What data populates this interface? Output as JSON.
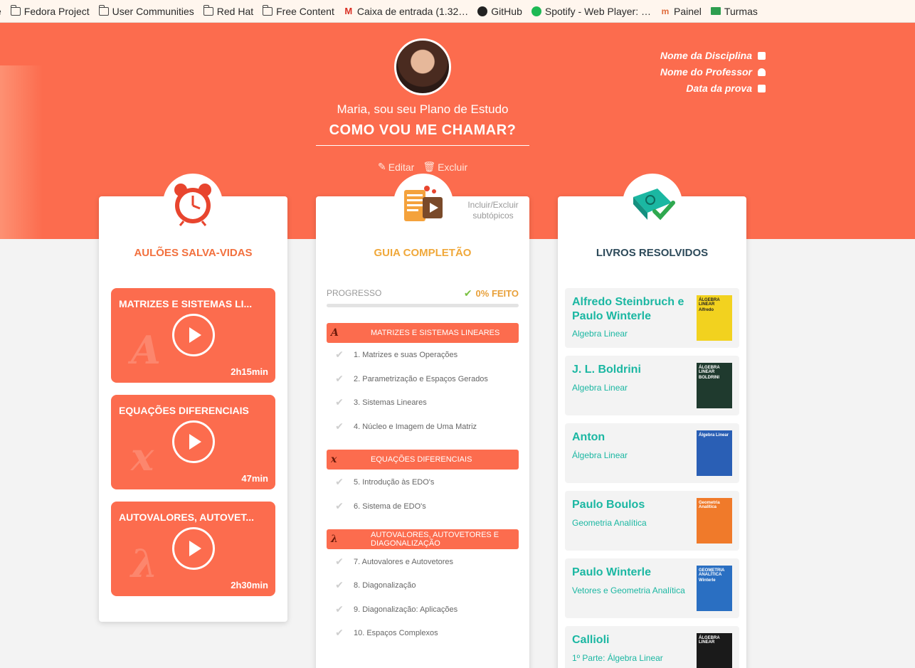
{
  "bookmarks": [
    {
      "label": "e",
      "icon": "none"
    },
    {
      "label": "Fedora Project",
      "icon": "folder-icon"
    },
    {
      "label": "User Communities",
      "icon": "folder-icon"
    },
    {
      "label": "Red Hat",
      "icon": "folder-icon"
    },
    {
      "label": "Free Content",
      "icon": "folder-icon"
    },
    {
      "label": "Caixa de entrada (1.32…",
      "icon": "gmail-icon"
    },
    {
      "label": "GitHub",
      "icon": "github-icon"
    },
    {
      "label": "Spotify - Web Player: …",
      "icon": "spotify-icon"
    },
    {
      "label": "Painel",
      "icon": "painel-icon"
    },
    {
      "label": "Turmas",
      "icon": "turmas-icon"
    }
  ],
  "header": {
    "intro": "Maria, sou seu Plano de Estudo",
    "name_placeholder": "COMO VOU ME CHAMAR?",
    "edit_label": "Editar",
    "delete_label": "Excluir",
    "links": {
      "discipline": "Nome da Disciplina",
      "professor": "Nome do Professor",
      "exam_date": "Data da prova"
    }
  },
  "videos_card": {
    "title": "AULÕES SALVA-VIDAS",
    "title_color": "#f2703e",
    "videos": [
      {
        "title": "MATRIZES E SISTEMAS LI...",
        "symbol": "A",
        "duration": "2h15min"
      },
      {
        "title": "EQUAÇÕES DIFERENCIAIS",
        "symbol": "x",
        "duration": "47min"
      },
      {
        "title": "AUTOVALORES, AUTOVET...",
        "symbol": "λ",
        "duration": "2h30min"
      }
    ]
  },
  "guide_card": {
    "title": "GUIA COMPLETÃO",
    "title_color": "#f0a83a",
    "include_label": "Incluir/Excluir subtópicos",
    "progress_label": "PROGRESSO",
    "progress_value": "0% FEITO",
    "progress_fraction": 0,
    "sections": [
      {
        "symbol": "A",
        "title": "MATRIZES E SISTEMAS LINEARES",
        "topics": [
          "1. Matrizes e suas Operações",
          "2. Parametrização e Espaços Gerados",
          "3. Sistemas Lineares",
          "4. Núcleo e Imagem de Uma Matriz"
        ]
      },
      {
        "symbol": "x",
        "title": "EQUAÇÕES DIFERENCIAIS",
        "topics": [
          "5. Introdução às EDO's",
          "6. Sistema de EDO's"
        ]
      },
      {
        "symbol": "λ",
        "title": "AUTOVALORES, AUTOVETORES E DIAGONALIZAÇÃO",
        "topics": [
          "7. Autovalores e Autovetores",
          "8. Diagonalização",
          "9. Diagonalização: Aplicações",
          "10. Espaços Complexos"
        ]
      }
    ]
  },
  "books_card": {
    "title": "LIVROS RESOLVIDOS",
    "title_color": "#2d4a5a",
    "books": [
      {
        "author": "Alfredo Steinbruch e Paulo Winterle",
        "subject": "Algebra Linear",
        "cover_color": "#f2d21f",
        "cover_text": "ÁLGEBRA LINEAR",
        "cover_sub": "Alfredo"
      },
      {
        "author": "J. L. Boldrini",
        "subject": "Algebra Linear",
        "cover_color": "#1f3a2e",
        "cover_text": "ÁLGEBRA LINEAR",
        "cover_sub": "BOLDRINI"
      },
      {
        "author": "Anton",
        "subject": "Álgebra Linear",
        "cover_color": "#2a5fb5",
        "cover_text": "Álgebra Linear",
        "cover_sub": ""
      },
      {
        "author": "Paulo Boulos",
        "subject": "Geometria Analítica",
        "cover_color": "#f07a2a",
        "cover_text": "Geometria Analítica",
        "cover_sub": ""
      },
      {
        "author": "Paulo Winterle",
        "subject": "Vetores e Geometria Analítica",
        "cover_color": "#2a6fc2",
        "cover_text": "GEOMETRIA ANALÍTICA",
        "cover_sub": "Winterle"
      },
      {
        "author": "Callioli",
        "subject": "1º Parte: Álgebra Linear",
        "cover_color": "#1a1a1a",
        "cover_text": "ÁLGEBRA LINEAR",
        "cover_sub": ""
      }
    ]
  }
}
